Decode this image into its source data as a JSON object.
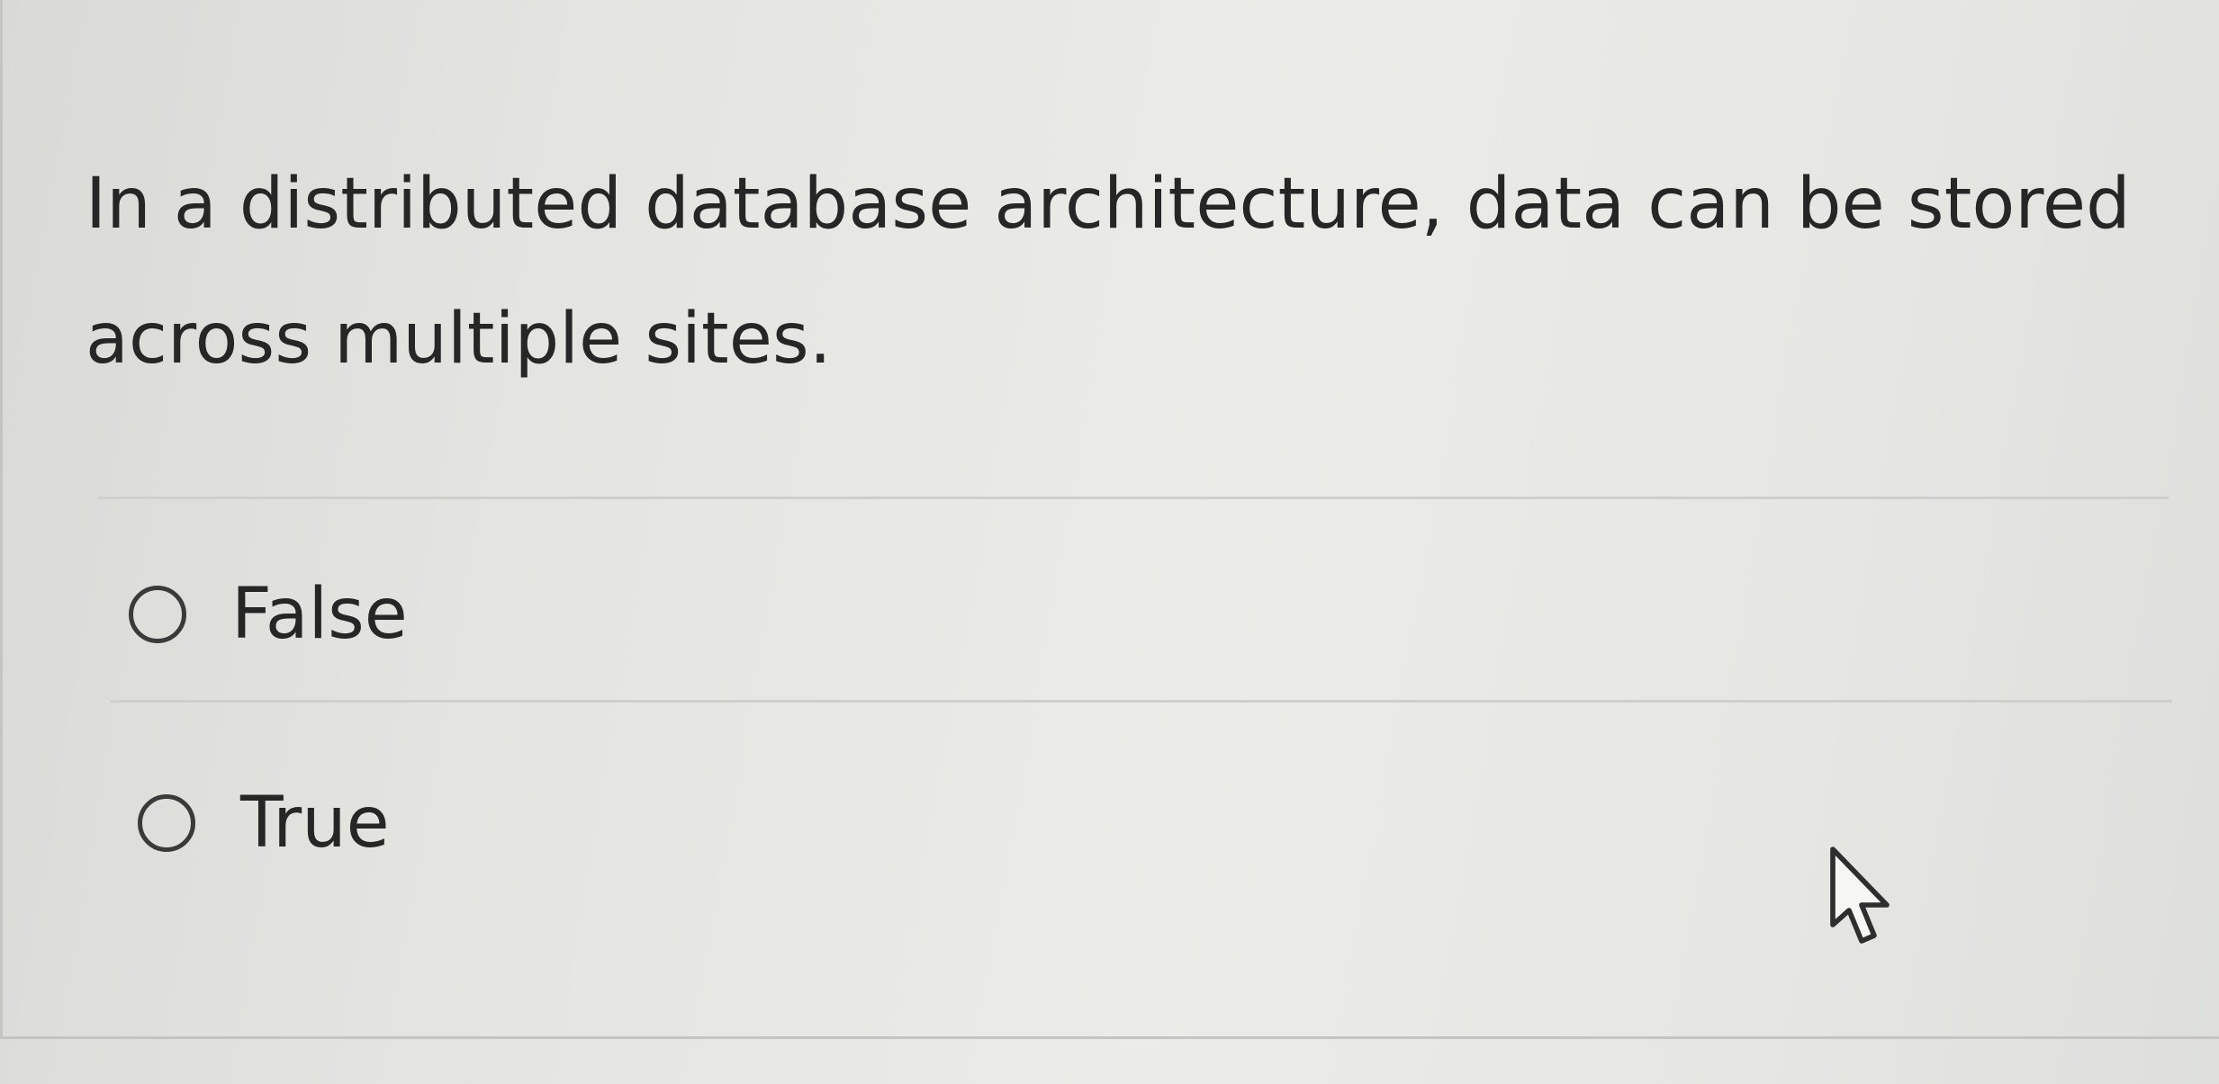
{
  "question": {
    "text": "In a distributed database architecture, data can be stored across multiple sites."
  },
  "options": [
    {
      "label": "False",
      "selected": false
    },
    {
      "label": "True",
      "selected": false
    }
  ],
  "icons": {
    "option_marker": "radio-circle-icon",
    "pointer": "mouse-cursor-icon"
  },
  "colors": {
    "text": "#262626",
    "divider": "#cfd0cc",
    "radio_border": "#3a3a3a"
  }
}
